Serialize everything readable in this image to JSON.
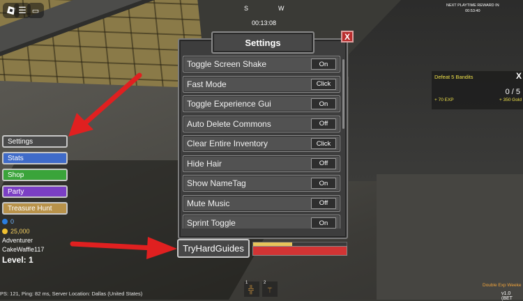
{
  "topbar": {
    "menu_icon": "roblox-logo-icon",
    "hamburger_icon": "hamburger-icon",
    "chat_icon": "chat-icon",
    "compass_s": "S",
    "compass_w": "W",
    "timer": "00:13:08",
    "playtime_reward_label": "NEXT PLAYTIME REWARD IN",
    "playtime_reward_time": "00:53:40"
  },
  "settings": {
    "title": "Settings",
    "close_label": "X",
    "rows": [
      {
        "label": "Toggle Screen Shake",
        "button": "On"
      },
      {
        "label": "Fast Mode",
        "button": "Click"
      },
      {
        "label": "Toggle Experience Gui",
        "button": "On"
      },
      {
        "label": "Auto Delete Commons",
        "button": "Off"
      },
      {
        "label": "Clear Entire Inventory",
        "button": "Click"
      },
      {
        "label": "Hide Hair",
        "button": "Off"
      },
      {
        "label": "Show NameTag",
        "button": "On"
      },
      {
        "label": "Mute Music",
        "button": "Off"
      },
      {
        "label": "Sprint Toggle",
        "button": "On"
      }
    ]
  },
  "menu": {
    "items": [
      {
        "label": "Settings",
        "color": "#4a4a4a"
      },
      {
        "label": "Stats",
        "color": "#3f6bc9"
      },
      {
        "label": "Shop",
        "color": "#3aa43a"
      },
      {
        "label": "Party",
        "color": "#7b3fc4"
      },
      {
        "label": "Treasure Hunt",
        "color": "#b8924a"
      }
    ]
  },
  "player": {
    "gems": "0",
    "gold": "25,000",
    "class": "Adventurer",
    "name": "CakeWaffle117",
    "level": "Level: 1",
    "xp_fraction": 0.42,
    "hp_fraction": 1.0
  },
  "quest": {
    "title": "Defeat 5 Bandits",
    "close": "X",
    "progress": "0 / 5",
    "exp_reward": "+ 70 EXP",
    "gold_reward": "+ 350 Gold"
  },
  "watermark": "TryHardGuides",
  "hotbar": [
    {
      "num": "1",
      "icon": "torch-icon"
    },
    {
      "num": "2",
      "icon": "broom-icon"
    }
  ],
  "status": "PS: 121, Ping: 82 ms, Server Location: Dallas (United States)",
  "double_exp": "Double Exp Weeke",
  "version": "v1.0 (BET"
}
